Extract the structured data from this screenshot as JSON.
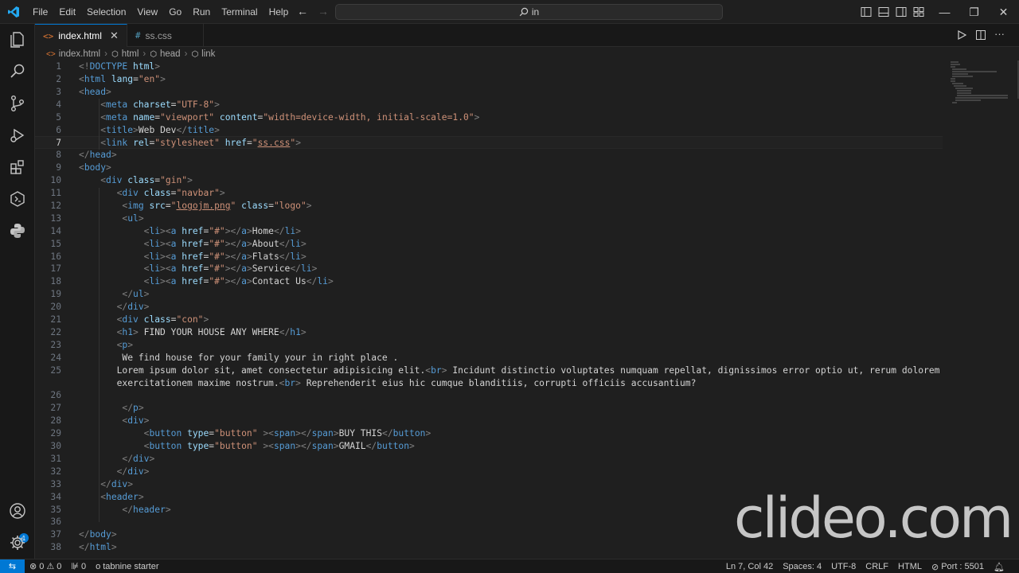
{
  "titlebar": {
    "menu": [
      "File",
      "Edit",
      "Selection",
      "View",
      "Go",
      "Run",
      "Terminal",
      "Help"
    ],
    "search_text": "in"
  },
  "tabs": [
    {
      "label": "index.html",
      "icon": "<>",
      "active": true
    },
    {
      "label": "ss.css",
      "icon": "#",
      "active": false
    }
  ],
  "breadcrumb": [
    "index.html",
    "html",
    "head",
    "link"
  ],
  "editor": {
    "current_line": 7,
    "lines": [
      {
        "n": "1",
        "html": "<span class='t'>&lt;!</span><span class='tag'>DOCTYPE</span> <span class='attr'>html</span><span class='t'>&gt;</span>"
      },
      {
        "n": "2",
        "html": "<span class='t'>&lt;</span><span class='tag'>html</span> <span class='attr'>lang</span>=<span class='str'>\"en\"</span><span class='t'>&gt;</span>"
      },
      {
        "n": "3",
        "html": "<span class='t'>&lt;</span><span class='tag'>head</span><span class='t'>&gt;</span>"
      },
      {
        "n": "4",
        "html": "    <span class='t'>&lt;</span><span class='tag'>meta</span> <span class='attr'>charset</span>=<span class='str'>\"UTF-8\"</span><span class='t'>&gt;</span>"
      },
      {
        "n": "5",
        "html": "    <span class='t'>&lt;</span><span class='tag'>meta</span> <span class='attr'>name</span>=<span class='str'>\"viewport\"</span> <span class='attr'>content</span>=<span class='str'>\"width=device-width, initial-scale=1.0\"</span><span class='t'>&gt;</span>"
      },
      {
        "n": "6",
        "html": "    <span class='t'>&lt;</span><span class='tag'>title</span><span class='t'>&gt;</span><span class='txt'>Web Dev</span><span class='t'>&lt;/</span><span class='tag'>title</span><span class='t'>&gt;</span>"
      },
      {
        "n": "7",
        "html": "    <span class='t'>&lt;</span><span class='tag'>link</span> <span class='attr'>rel</span>=<span class='str'>\"stylesheet\"</span> <span class='attr'>href</span>=<span class='str'>\"<span class='under'>ss.css</span>\"</span><span class='t'>&gt;</span>"
      },
      {
        "n": "8",
        "html": "<span class='t'>&lt;/</span><span class='tag'>head</span><span class='t'>&gt;</span>"
      },
      {
        "n": "9",
        "html": "<span class='t'>&lt;</span><span class='tag'>body</span><span class='t'>&gt;</span>"
      },
      {
        "n": "10",
        "html": "    <span class='t'>&lt;</span><span class='tag'>div</span> <span class='attr'>class</span>=<span class='str'>\"gin\"</span><span class='t'>&gt;</span>"
      },
      {
        "n": "11",
        "html": "       <span class='t'>&lt;</span><span class='tag'>div</span> <span class='attr'>class</span>=<span class='str'>\"navbar\"</span><span class='t'>&gt;</span>"
      },
      {
        "n": "12",
        "html": "        <span class='t'>&lt;</span><span class='tag'>img</span> <span class='attr'>src</span>=<span class='str'>\"<span class='under'>logojm.png</span>\"</span> <span class='attr'>class</span>=<span class='str'>\"logo\"</span><span class='t'>&gt;</span>"
      },
      {
        "n": "13",
        "html": "        <span class='t'>&lt;</span><span class='tag'>ul</span><span class='t'>&gt;</span>"
      },
      {
        "n": "14",
        "html": "            <span class='t'>&lt;</span><span class='tag'>li</span><span class='t'>&gt;&lt;</span><span class='tag'>a</span> <span class='attr'>href</span>=<span class='str'>\"#\"</span><span class='t'>&gt;&lt;/</span><span class='tag'>a</span><span class='t'>&gt;</span><span class='txt'>Home</span><span class='t'>&lt;/</span><span class='tag'>li</span><span class='t'>&gt;</span>"
      },
      {
        "n": "15",
        "html": "            <span class='t'>&lt;</span><span class='tag'>li</span><span class='t'>&gt;&lt;</span><span class='tag'>a</span> <span class='attr'>href</span>=<span class='str'>\"#\"</span><span class='t'>&gt;&lt;/</span><span class='tag'>a</span><span class='t'>&gt;</span><span class='txt'>About</span><span class='t'>&lt;/</span><span class='tag'>li</span><span class='t'>&gt;</span>"
      },
      {
        "n": "16",
        "html": "            <span class='t'>&lt;</span><span class='tag'>li</span><span class='t'>&gt;&lt;</span><span class='tag'>a</span> <span class='attr'>href</span>=<span class='str'>\"#\"</span><span class='t'>&gt;&lt;/</span><span class='tag'>a</span><span class='t'>&gt;</span><span class='txt'>Flats</span><span class='t'>&lt;/</span><span class='tag'>li</span><span class='t'>&gt;</span>"
      },
      {
        "n": "17",
        "html": "            <span class='t'>&lt;</span><span class='tag'>li</span><span class='t'>&gt;&lt;</span><span class='tag'>a</span> <span class='attr'>href</span>=<span class='str'>\"#\"</span><span class='t'>&gt;&lt;/</span><span class='tag'>a</span><span class='t'>&gt;</span><span class='txt'>Service</span><span class='t'>&lt;/</span><span class='tag'>li</span><span class='t'>&gt;</span>"
      },
      {
        "n": "18",
        "html": "            <span class='t'>&lt;</span><span class='tag'>li</span><span class='t'>&gt;&lt;</span><span class='tag'>a</span> <span class='attr'>href</span>=<span class='str'>\"#\"</span><span class='t'>&gt;&lt;/</span><span class='tag'>a</span><span class='t'>&gt;</span><span class='txt'>Contact Us</span><span class='t'>&lt;/</span><span class='tag'>li</span><span class='t'>&gt;</span>"
      },
      {
        "n": "19",
        "html": "        <span class='t'>&lt;/</span><span class='tag'>ul</span><span class='t'>&gt;</span>"
      },
      {
        "n": "20",
        "html": "       <span class='t'>&lt;/</span><span class='tag'>div</span><span class='t'>&gt;</span>"
      },
      {
        "n": "21",
        "html": "       <span class='t'>&lt;</span><span class='tag'>div</span> <span class='attr'>class</span>=<span class='str'>\"con\"</span><span class='t'>&gt;</span>"
      },
      {
        "n": "22",
        "html": "       <span class='t'>&lt;</span><span class='tag'>h1</span><span class='t'>&gt;</span><span class='txt'> FIND YOUR HOUSE ANY WHERE</span><span class='t'>&lt;/</span><span class='tag'>h1</span><span class='t'>&gt;</span>"
      },
      {
        "n": "23",
        "html": "       <span class='t'>&lt;</span><span class='tag'>p</span><span class='t'>&gt;</span>"
      },
      {
        "n": "24",
        "html": "        <span class='txt'>We find house for your family your in right place .</span>"
      },
      {
        "n": "25",
        "html": "       <span class='txt'>Lorem ipsum dolor sit, amet consectetur adipisicing elit.</span><span class='t'>&lt;</span><span class='tag'>br</span><span class='t'>&gt;</span><span class='txt'> Incidunt distinctio voluptates numquam repellat, dignissimos error optio ut, rerum dolorem</span>"
      },
      {
        "n": "",
        "html": "       <span class='txt'>exercitationem maxime nostrum.</span><span class='t'>&lt;</span><span class='tag'>br</span><span class='t'>&gt;</span><span class='txt'> Reprehenderit eius hic cumque blanditiis, corrupti officiis accusantium?</span>"
      },
      {
        "n": "",
        "html": ""
      },
      {
        "n": "26",
        "html": ""
      },
      {
        "n": "27",
        "html": "        <span class='t'>&lt;/</span><span class='tag'>p</span><span class='t'>&gt;</span>"
      },
      {
        "n": "28",
        "html": "        <span class='t'>&lt;</span><span class='tag'>div</span><span class='t'>&gt;</span>"
      },
      {
        "n": "29",
        "html": "            <span class='t'>&lt;</span><span class='tag'>button</span> <span class='attr'>type</span>=<span class='str'>\"button\"</span> <span class='t'>&gt;&lt;</span><span class='tag'>span</span><span class='t'>&gt;&lt;/</span><span class='tag'>span</span><span class='t'>&gt;</span><span class='txt'>BUY THIS</span><span class='t'>&lt;/</span><span class='tag'>button</span><span class='t'>&gt;</span>"
      },
      {
        "n": "30",
        "html": "            <span class='t'>&lt;</span><span class='tag'>button</span> <span class='attr'>type</span>=<span class='str'>\"button\"</span> <span class='t'>&gt;&lt;</span><span class='tag'>span</span><span class='t'>&gt;&lt;/</span><span class='tag'>span</span><span class='t'>&gt;</span><span class='txt'>GMAIL</span><span class='t'>&lt;/</span><span class='tag'>button</span><span class='t'>&gt;</span>"
      },
      {
        "n": "31",
        "html": "        <span class='t'>&lt;/</span><span class='tag'>div</span><span class='t'>&gt;</span>"
      },
      {
        "n": "32",
        "html": "       <span class='t'>&lt;/</span><span class='tag'>div</span><span class='t'>&gt;</span>"
      },
      {
        "n": "33",
        "html": "    <span class='t'>&lt;/</span><span class='tag'>div</span><span class='t'>&gt;</span>"
      },
      {
        "n": "34",
        "html": "    <span class='t'>&lt;</span><span class='tag'>header</span><span class='t'>&gt;</span>"
      },
      {
        "n": "35",
        "html": "        <span class='t'>&lt;/</span><span class='tag'>header</span><span class='t'>&gt;</span>"
      },
      {
        "n": "36",
        "html": ""
      },
      {
        "n": "37",
        "html": "<span class='t'>&lt;/</span><span class='tag'>body</span><span class='t'>&gt;</span>"
      },
      {
        "n": "38",
        "html": "<span class='t'>&lt;/</span><span class='tag'>html</span><span class='t'>&gt;</span>"
      }
    ]
  },
  "watermark": "clideo.com",
  "statusbar": {
    "problems_errors": "0",
    "problems_warnings": "0",
    "ports_count": "0",
    "tabnine": "tabnine starter",
    "cursor": "Ln 7, Col 42",
    "spaces": "Spaces: 4",
    "encoding": "UTF-8",
    "eol": "CRLF",
    "language": "HTML",
    "port": "Port : 5501"
  },
  "activity_badge": "1",
  "colors": {
    "accent": "#0078d4",
    "tag": "#569cd6",
    "attr": "#9cdcfe",
    "string": "#ce9178"
  }
}
